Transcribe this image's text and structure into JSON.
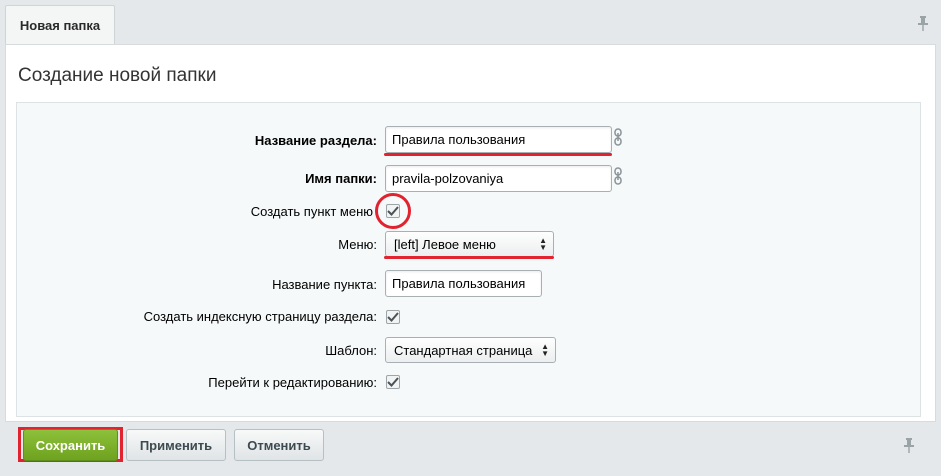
{
  "tab": {
    "label": "Новая папка"
  },
  "panel": {
    "title": "Создание новой папки"
  },
  "form": {
    "section_name": {
      "label": "Название раздела:",
      "value": "Правила пользования"
    },
    "folder_name": {
      "label": "Имя папки:",
      "value": "pravila-polzovaniya"
    },
    "create_menu_item": {
      "label": "Создать пункт меню",
      "checked": true
    },
    "menu": {
      "label": "Меню:",
      "value": "[left] Левое меню"
    },
    "item_name": {
      "label": "Название пункта:",
      "value": "Правила пользования"
    },
    "create_index": {
      "label": "Создать индексную страницу раздела:",
      "checked": true
    },
    "template": {
      "label": "Шаблон:",
      "value": "Стандартная страница"
    },
    "go_edit": {
      "label": "Перейти к редактированию:",
      "checked": true
    }
  },
  "buttons": {
    "save": "Сохранить",
    "apply": "Применить",
    "cancel": "Отменить"
  },
  "colors": {
    "accent_green": "#7bb12a",
    "highlight_red": "#e0232e"
  },
  "icons": [
    "pin-icon",
    "link-icon",
    "checkmark-icon",
    "select-arrows-icon"
  ]
}
